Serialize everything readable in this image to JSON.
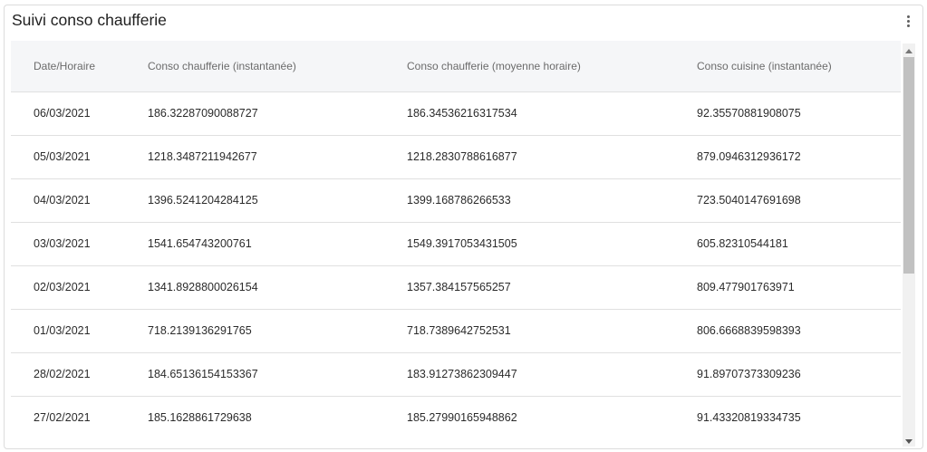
{
  "widget": {
    "title": "Suivi conso chaufferie",
    "menu_icon": "more-vertical-icon"
  },
  "table": {
    "columns": [
      "Date/Horaire",
      "Conso chaufferie (instantanée)",
      "Conso chaufferie (moyenne horaire)",
      "Conso cuisine (instantanée)"
    ],
    "rows": [
      [
        "06/03/2021",
        "186.32287090088727",
        "186.34536216317534",
        "92.35570881908075"
      ],
      [
        "05/03/2021",
        "1218.3487211942677",
        "1218.2830788616877",
        "879.0946312936172"
      ],
      [
        "04/03/2021",
        "1396.5241204284125",
        "1399.168786266533",
        "723.5040147691698"
      ],
      [
        "03/03/2021",
        "1541.654743200761",
        "1549.3917053431505",
        "605.82310544181"
      ],
      [
        "02/03/2021",
        "1341.8928800026154",
        "1357.384157565257",
        "809.477901763971"
      ],
      [
        "01/03/2021",
        "718.2139136291765",
        "718.7389642752531",
        "806.6668839598393"
      ],
      [
        "28/02/2021",
        "184.65136154153367",
        "183.91273862309447",
        "91.89707373309236"
      ],
      [
        "27/02/2021",
        "185.1628861729638",
        "185.27990165948862",
        "91.43320819334735"
      ]
    ]
  },
  "scrollbar": {
    "position": 0
  }
}
